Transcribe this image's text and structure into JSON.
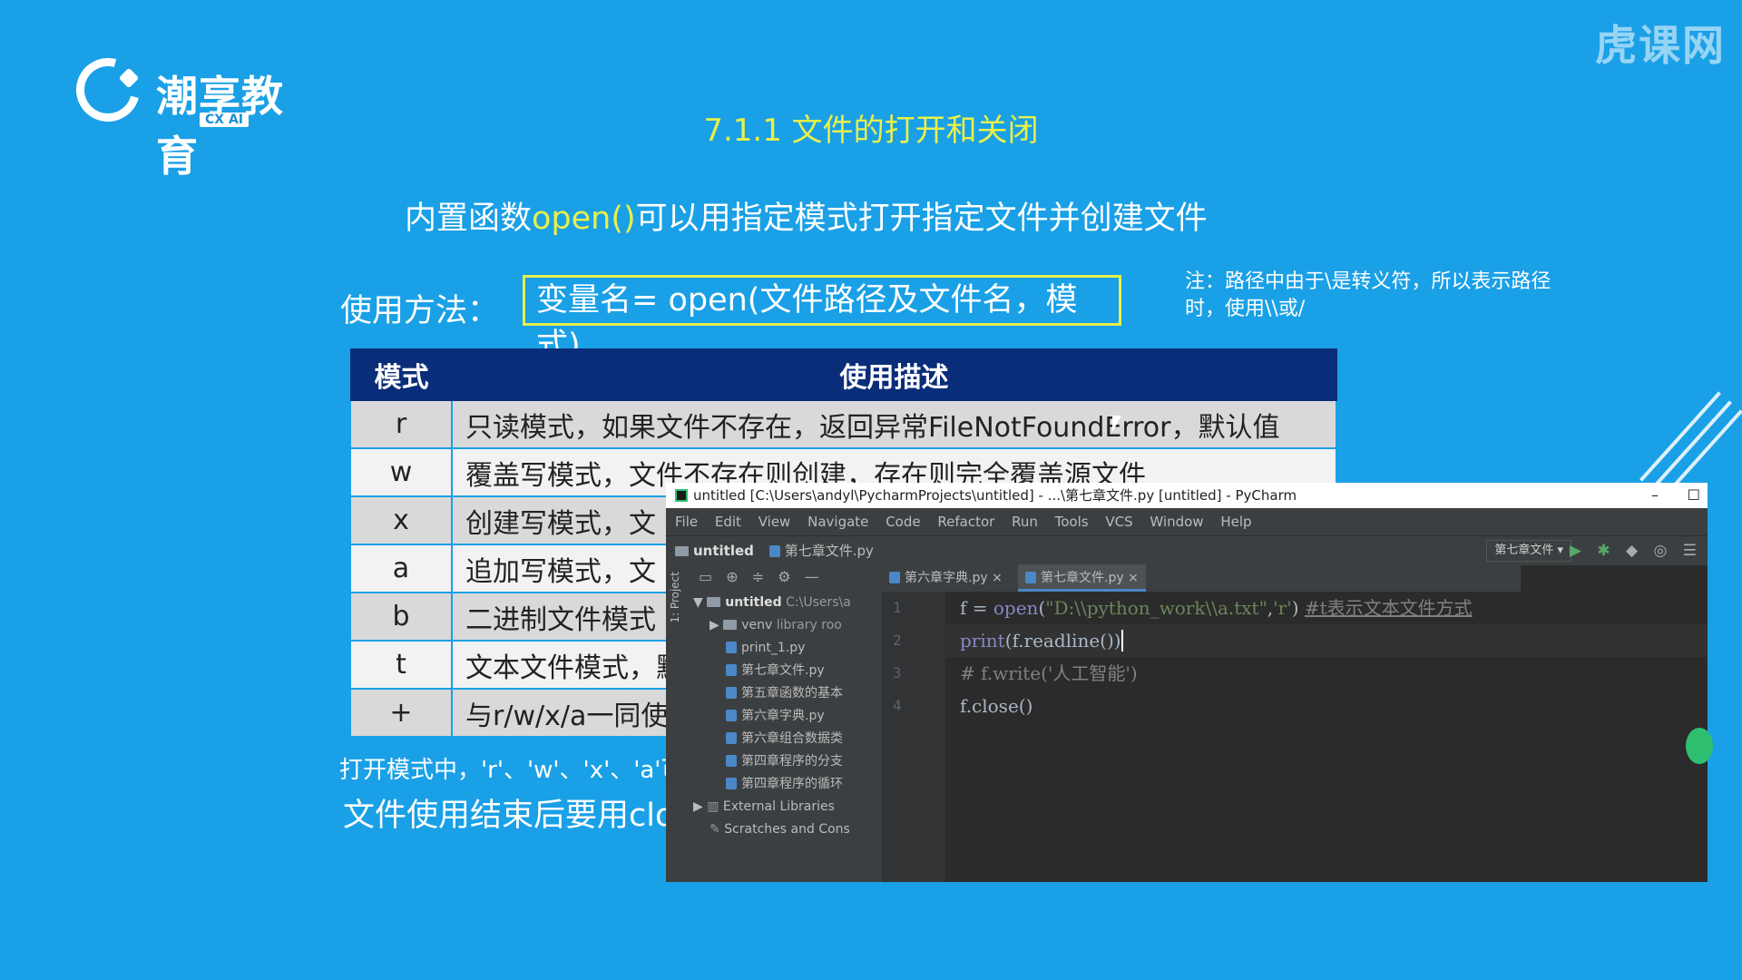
{
  "logo": {
    "name": "潮享教育",
    "tag": "CX AI"
  },
  "watermark": "虎课网",
  "slide": {
    "title": "7.1.1 文件的打开和关闭",
    "intro_prefix": "内置函数",
    "intro_highlight": "open()",
    "intro_suffix": "可以用指定模式打开指定文件并创建文件",
    "usage_label": "使用方法：",
    "usage_syntax": "变量名= open(文件路径及文件名，模式)",
    "note": "注：路径中由于\\是转义符，所以表示路径时，使用\\\\或/",
    "table": {
      "headers": [
        "模式",
        "使用描述"
      ],
      "rows": [
        {
          "mode": "r",
          "desc": "只读模式，如果文件不存在，返回异常FileNotFoundError，默认值"
        },
        {
          "mode": "w",
          "desc": "覆盖写模式，文件不存在则创建，存在则完全覆盖源文件"
        },
        {
          "mode": "x",
          "desc": "创建写模式，文"
        },
        {
          "mode": "a",
          "desc": "追加写模式，文"
        },
        {
          "mode": "b",
          "desc": "二进制文件模式"
        },
        {
          "mode": "t",
          "desc": "文本文件模式，默"
        },
        {
          "mode": "+",
          "desc": "与r/w/x/a一同使"
        }
      ]
    },
    "footer1": "打开模式中，'r'、'w'、'x'、'a'可",
    "footer2": "文件使用结束后要用clo"
  },
  "ide": {
    "title": "untitled [C:\\Users\\andyl\\PycharmProjects\\untitled] - ...\\第七章文件.py [untitled] - PyCharm",
    "window_buttons": {
      "minimize": "–",
      "maximize": "☐"
    },
    "menu": [
      "File",
      "Edit",
      "View",
      "Navigate",
      "Code",
      "Refactor",
      "Run",
      "Tools",
      "VCS",
      "Window",
      "Help"
    ],
    "breadcrumb": [
      "untitled",
      "第七章文件.py"
    ],
    "run_config": "第七章文件",
    "side_label": "1: Project",
    "tabs": [
      "第六章字典.py",
      "第七章文件.py"
    ],
    "tree": [
      {
        "label": "untitled",
        "extra": "C:\\Users\\a",
        "type": "folder",
        "level": 0,
        "arrow": "▼"
      },
      {
        "label": "venv",
        "extra": "library roo",
        "type": "folder",
        "level": 1,
        "arrow": "▶"
      },
      {
        "label": "print_1.py",
        "type": "file",
        "level": 2
      },
      {
        "label": "第七章文件.py",
        "type": "file",
        "level": 2
      },
      {
        "label": "第五章函数的基本",
        "type": "file",
        "level": 2
      },
      {
        "label": "第六章字典.py",
        "type": "file",
        "level": 2
      },
      {
        "label": "第六章组合数据类",
        "type": "file",
        "level": 2
      },
      {
        "label": "第四章程序的分支",
        "type": "file",
        "level": 2
      },
      {
        "label": "第四章程序的循环",
        "type": "file",
        "level": 2
      },
      {
        "label": "External Libraries",
        "type": "lib",
        "level": 0,
        "arrow": "▶"
      },
      {
        "label": "Scratches and Cons",
        "type": "scratch",
        "level": 1
      }
    ],
    "line_numbers": [
      "1",
      "2",
      "3",
      "4"
    ],
    "code": {
      "l1_a": "f = ",
      "l1_b": "open",
      "l1_c": "(",
      "l1_d": "\"D:\\\\python_work\\\\a.txt\"",
      "l1_e": ",",
      "l1_f": "'r'",
      "l1_g": ") ",
      "l1_h": "#t表示文本文件方式",
      "l2_a": "print",
      "l2_b": "(f.readline())",
      "l3": "# f.write('人工智能')",
      "l4": "f.close()"
    }
  }
}
